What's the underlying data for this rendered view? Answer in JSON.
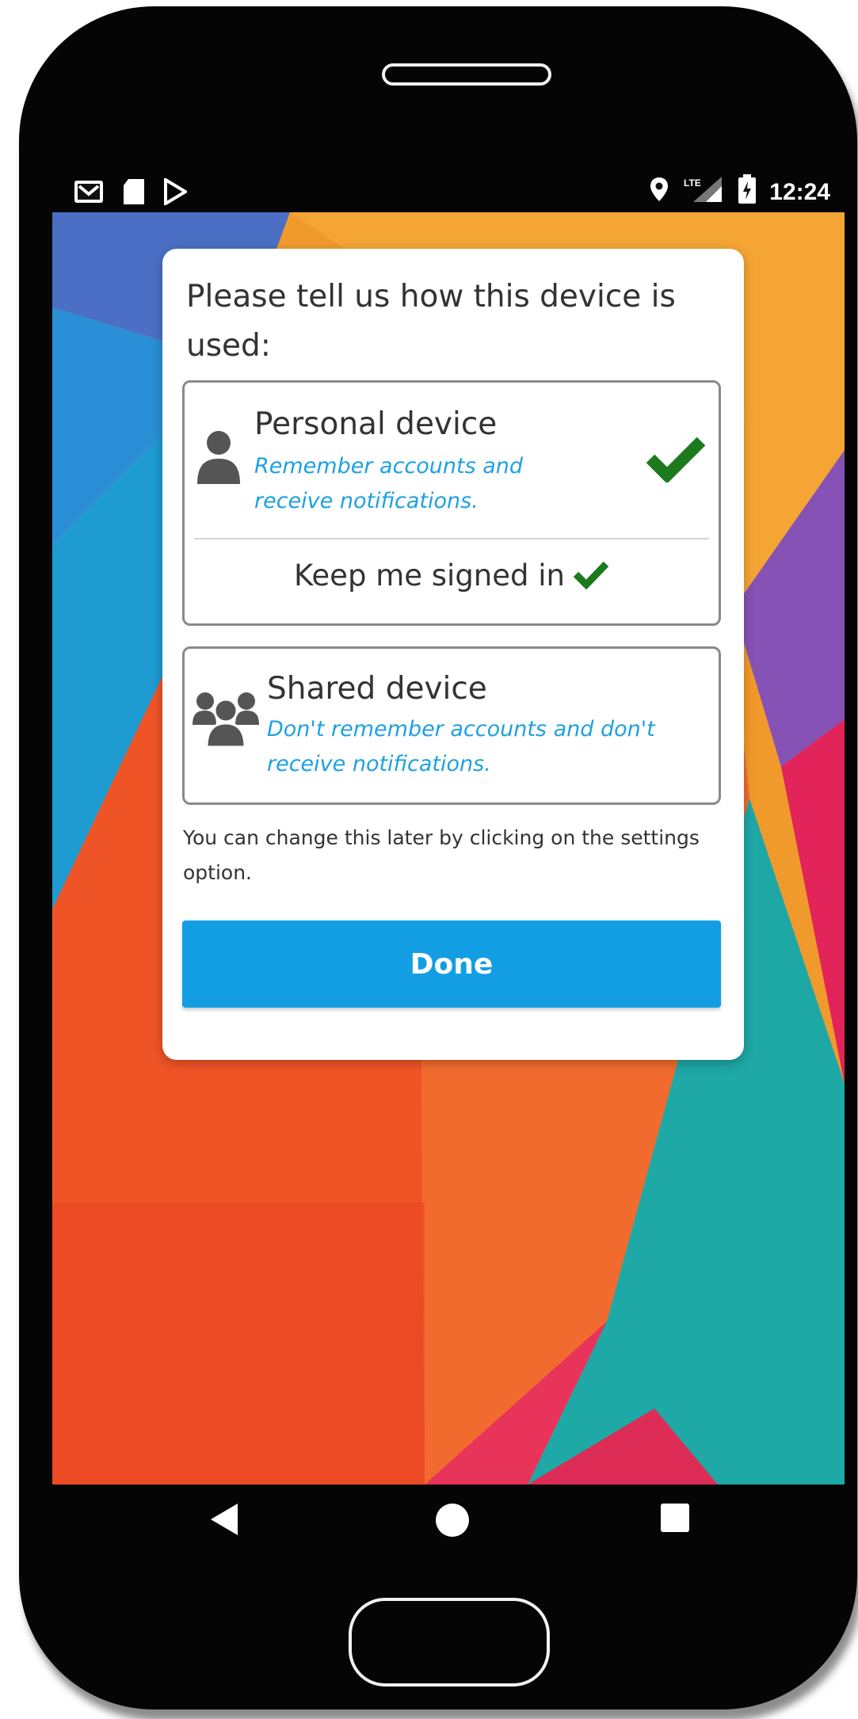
{
  "status_bar": {
    "left_icons": [
      "gmail-icon",
      "sd-card-icon",
      "play-store-icon"
    ],
    "right_icons": [
      "location-icon",
      "lte-signal-icon",
      "battery-icon"
    ],
    "network_label": "LTE",
    "time": "12:24"
  },
  "dialog": {
    "title": "Please tell us how this device is used:",
    "personal": {
      "title": "Personal device",
      "description": "Remember accounts and receive notifications.",
      "icon": "user-icon",
      "selected": true,
      "keep_signed_in_label": "Keep me signed in",
      "keep_signed_in_checked": true
    },
    "shared": {
      "title": "Shared device",
      "description": "Don't remember accounts and don't receive notifications.",
      "icon": "users-group-icon",
      "selected": false
    },
    "hint": "You can change this later by clicking on the settings option.",
    "done_label": "Done"
  },
  "navigation_bar": {
    "icons": [
      "back-icon",
      "home-icon",
      "recents-icon"
    ]
  },
  "colors": {
    "accent": "#139ee4",
    "description_text": "#1ea1e0",
    "check": "#1b7a1b"
  }
}
